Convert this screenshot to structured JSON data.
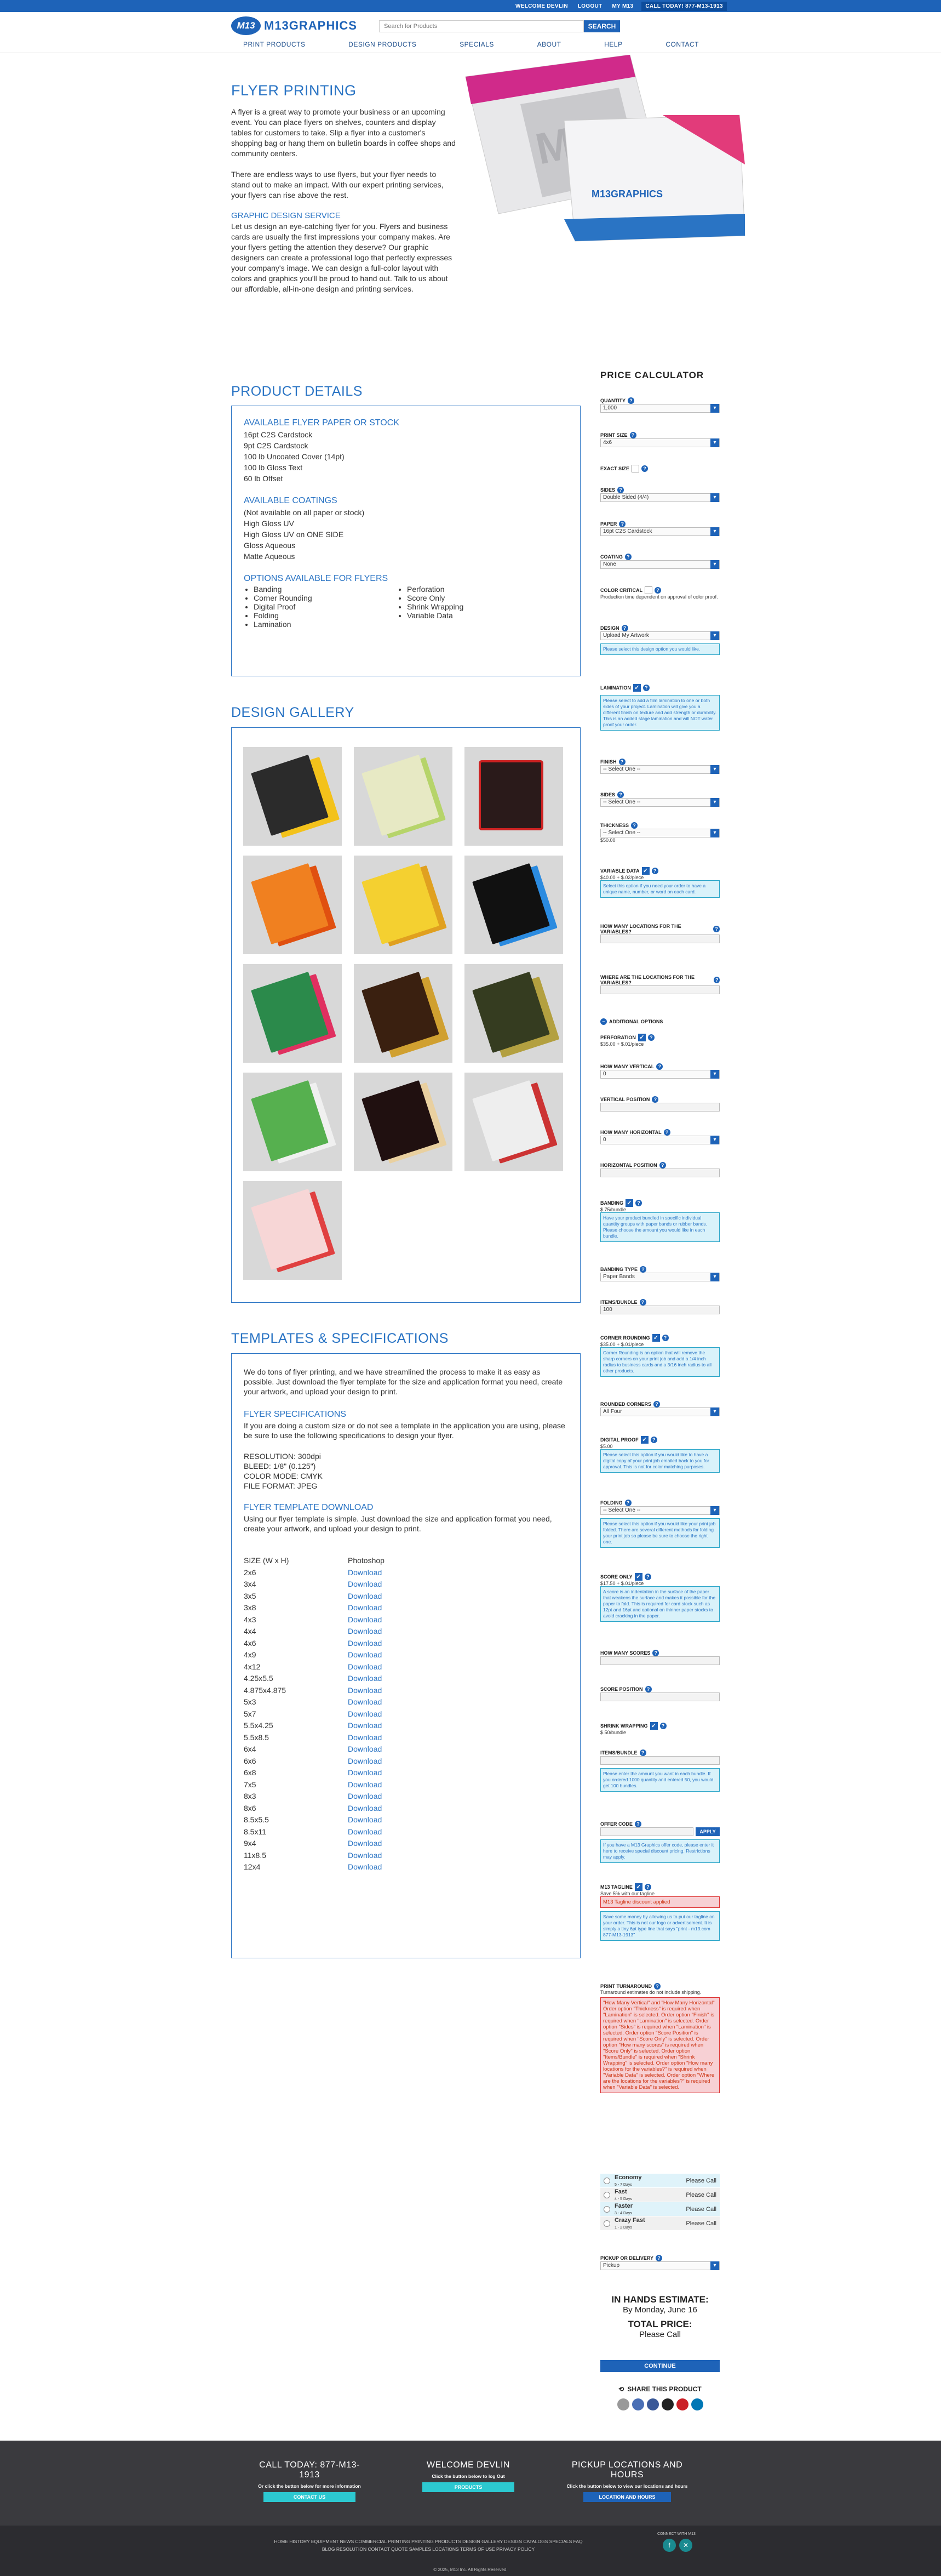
{
  "topbar": {
    "welcome": "WELCOME DEVLIN",
    "logout": "LOGOUT",
    "my": "MY M13",
    "call": "CALL TODAY! 877-M13-1913"
  },
  "header": {
    "brand": "M13GRAPHICS",
    "brand_mark": "M13",
    "search_placeholder": "Search for Products",
    "search_button": "SEARCH"
  },
  "nav": [
    "PRINT PRODUCTS",
    "DESIGN PRODUCTS",
    "SPECIALS",
    "ABOUT",
    "HELP",
    "CONTACT"
  ],
  "hero": {
    "title": "FLYER PRINTING",
    "p1": "A flyer is a great way to promote your business or an upcoming event. You can place flyers on shelves, counters and display tables for customers to take. Slip a flyer into a customer's shopping bag or hang them on bulletin boards in coffee shops and community centers.",
    "p2": "There are endless ways to use flyers, but your flyer needs to stand out to make an impact. With our expert printing services, your flyers can rise above the rest.",
    "sub": "GRAPHIC DESIGN SERVICE",
    "p3": "Let us design an eye-catching flyer for you. Flyers and business cards are usually the first impressions your company makes. Are your flyers getting the attention they deserve? Our graphic designers can create a professional logo that perfectly expresses your company's image. We can design a full-color layout with colors and graphics you'll be proud to hand out. Talk to us about our affordable, all-in-one design and printing services."
  },
  "details": {
    "title": "PRODUCT DETAILS",
    "papers_h": "AVAILABLE FLYER PAPER OR STOCK",
    "papers": [
      "16pt C2S Cardstock",
      "9pt C2S Cardstock",
      "100 lb Uncoated Cover (14pt)",
      "100 lb Gloss Text",
      "60 lb Offset"
    ],
    "coat_h": "AVAILABLE COATINGS",
    "coats": [
      "(Not available on all paper or stock)",
      "High Gloss UV",
      "High Gloss UV on ONE SIDE",
      "Gloss Aqueous",
      "Matte Aqueous"
    ],
    "opts_h": "OPTIONS AVAILABLE FOR FLYERS",
    "opts_a": [
      "Banding",
      "Corner Rounding",
      "Digital Proof",
      "Folding",
      "Lamination"
    ],
    "opts_b": [
      "Perforation",
      "Score Only",
      "Shrink Wrapping",
      "Variable Data"
    ]
  },
  "gallery": {
    "title": "DESIGN GALLERY"
  },
  "templates": {
    "title": "TEMPLATES & SPECIFICATIONS",
    "intro": "We do tons of flyer printing, and we have streamlined the process to make it as easy as possible. Just download the flyer template for the size and application format you need, create your artwork, and upload your design to print.",
    "spec_h": "FLYER SPECIFICATIONS",
    "spec_p": "If you are doing a custom size or do not see a template in the application you are using, please be sure to use the following specifications to design your flyer.",
    "res": "RESOLUTION: 300dpi",
    "bleed": "BLEED: 1/8\" (0.125\")",
    "mode": "COLOR MODE: CMYK",
    "fmt": "FILE FORMAT: JPEG",
    "dl_h": "FLYER TEMPLATE DOWNLOAD",
    "dl_p": "Using our flyer template is simple. Just download the size and application format you need, create your artwork, and upload your design to print.",
    "col1": "SIZE (W x H)",
    "col2": "Photoshop",
    "link": "Download",
    "sizes": [
      "2x6",
      "3x4",
      "3x5",
      "3x8",
      "4x3",
      "4x4",
      "4x6",
      "4x9",
      "4x12",
      "4.25x5.5",
      "4.875x4.875",
      "5x3",
      "5x7",
      "5.5x4.25",
      "5.5x8.5",
      "6x4",
      "6x6",
      "6x8",
      "7x5",
      "8x3",
      "8x6",
      "8.5x5.5",
      "8.5x11",
      "9x4",
      "11x8.5",
      "12x4"
    ]
  },
  "calc": {
    "title": "PRICE CALCULATOR",
    "qty_l": "QUANTITY",
    "qty": "1,000",
    "size_l": "PRINT SIZE",
    "size": "4x6",
    "exact_l": "EXACT SIZE",
    "sides_l": "SIDES",
    "sides": "Double Sided (4/4)",
    "paper_l": "PAPER",
    "paper": "16pt C2S Cardstock",
    "coat_l": "COATING",
    "coat": "None",
    "cc_l": "COLOR CRITICAL",
    "cc_note": "Production time dependent on approval of color proof.",
    "design_l": "DESIGN",
    "design": "Upload My Artwork",
    "design_note": "Please select this design option you would like.",
    "lam_l": "LAMINATION",
    "lam_note": "Please select to add a film lamination to one or both sides of your project. Lamination will give you a different finish on texture and add strength or durability. This is an added stage lamination and will NOT water proof your order.",
    "finish_l": "FINISH",
    "finish": "-- Select One --",
    "lsides_l": "SIDES",
    "lsides": "-- Select One --",
    "thick_l": "THICKNESS",
    "thick": "-- Select One --",
    "thick_p": "$50.00",
    "vd_l": "VARIABLE DATA",
    "vd_p": "$40.00 + $.02/piece",
    "vd_note": "Select this option if you need your order to have a unique name, number, or word on each card.",
    "vloc_l": "HOW MANY LOCATIONS FOR THE VARIABLES?",
    "where_l": "WHERE ARE THE LOCATIONS FOR THE VARIABLES?",
    "addl": "ADDITIONAL OPTIONS",
    "perf_l": "PERFORATION",
    "perf_p": "$35.00 + $.01/piece",
    "hv_l": "HOW MANY VERTICAL",
    "hv": "0",
    "vpos_l": "VERTICAL POSITION",
    "hh_l": "HOW MANY HORIZONTAL",
    "hh": "0",
    "hpos_l": "HORIZONTAL POSITION",
    "band_l": "BANDING",
    "band_p": "$.75/bundle",
    "band_note": "Have your product bundled in specific individual quantity groups with paper bands or rubber bands. Please choose the amount you would like in each bundle.",
    "btype_l": "BANDING TYPE",
    "btype": "Paper Bands",
    "ipb_l": "ITEMS/BUNDLE",
    "ipb": "100",
    "corner_l": "CORNER ROUNDING",
    "corner_p": "$35.00 + $.01/piece",
    "corner_note": "Corner Rounding is an option that will remove the sharp corners on your print job and add a 1/4 inch radius to business cards and a 3/16 inch radius to all other products.",
    "rc_l": "ROUNDED CORNERS",
    "rc": "All Four",
    "dp_l": "DIGITAL PROOF",
    "dp_p": "$5.00",
    "dp_note": "Please select this option if you would like to have a digital copy of your print job emailed back to you for approval. This is not for color matching purposes.",
    "fold_l": "FOLDING",
    "fold": "-- Select One --",
    "fold_note": "Please select this option if you would like your print job folded. There are several different methods for folding your print job so please be sure to choose the right one.",
    "score_l": "SCORE ONLY",
    "score_p": "$17.50 + $.01/piece",
    "score_note": "A score is an indentation in the surface of the paper that weakens the surface and makes it possible for the paper to fold. This is required for card stock such as 12pt and 16pt and optional on thinner paper stocks to avoid cracking in the paper.",
    "hs_l": "HOW MANY SCORES",
    "spos_l": "SCORE POSITION",
    "shrink_l": "SHRINK WRAPPING",
    "shrink_p": "$.50/bundle",
    "ipb2_l": "ITEMS/BUNDLE",
    "shrink_note": "Please enter the amount you want in each bundle. If you ordered 1000 quantity and entered 50, you would get 100 bundles.",
    "offer_l": "OFFER CODE",
    "apply": "APPLY",
    "offer_note": "If you have a M13 Graphics offer code, please enter it here to receive special discount pricing. Restrictions may apply.",
    "tag_l": "M13 TAGLINE",
    "tag_p": "Save 5% with our tagline",
    "tag_err": "M13 Tagline discount applied",
    "tag_note": "Save some money by allowing us to put our tagline on your order. This is not our logo or advertisement. It is simply a tiny 6pt type line that says \"print - m13.com 877-M13-1913\"",
    "turn_l": "PRINT TURNAROUND",
    "turn_note": "Turnaround estimates do not include shipping.",
    "turn_err": "\"How Many Vertical\" and \"How Many Horizontal\" Order option \"Thickness\" is required when \"Lamination\" is selected. Order option \"Finish\" is required when \"Lamination\" is selected. Order option \"Sides\" is required when \"Lamination\" is selected. Order option \"Score Position\" is required when \"Score Only\" is selected. Order option \"How many scores\" is required when \"Score Only\" is selected. Order option \"Items/Bundle\" is required when \"Shrink Wrapping\" is selected. Order option \"How many locations for the variables?\" is required when \"Variable Data\" is selected. Order option \"Where are the locations for the variables?\" is required when \"Variable Data\" is selected.",
    "turns": [
      {
        "n": "Economy",
        "d": "5 - 7 Days",
        "p": "Please Call"
      },
      {
        "n": "Fast",
        "d": "4 - 5 Days",
        "p": "Please Call"
      },
      {
        "n": "Faster",
        "d": "3 - 4 Days",
        "p": "Please Call"
      },
      {
        "n": "Crazy Fast",
        "d": "1 - 2 Days",
        "p": "Please Call"
      }
    ],
    "pickup_l": "PICKUP OR DELIVERY",
    "pickup": "Pickup",
    "inhands_l": "IN HANDS ESTIMATE:",
    "inhands": "By Monday, June 16",
    "total_l": "TOTAL PRICE:",
    "total": "Please Call",
    "cont": "CONTINUE",
    "share": "SHARE THIS PRODUCT"
  },
  "footer": {
    "c1t": "CALL TODAY: 877-M13-1913",
    "c1s": "Or click the button below for more information",
    "c1b": "CONTACT US",
    "c2t": "WELCOME DEVLIN",
    "c2s": "Click the button below to log Out",
    "c2b": "PRODUCTS",
    "c3t": "PICKUP LOCATIONS AND HOURS",
    "c3s": "Click the button below to view our locations and hours",
    "c3b": "LOCATION AND HOURS",
    "links1": "HOME   HISTORY   EQUIPMENT   NEWS   COMMERCIAL PRINTING   PRINTING PRODUCTS   DESIGN GALLERY   DESIGN CATALOGS   SPECIALS   FAQ",
    "links2": "BLOG   RESOLUTION   CONTACT   QUOTE   SAMPLES   LOCATIONS   TERMS OF USE   PRIVACY POLICY",
    "connect": "CONNECT WITH M13",
    "copy": "© 2025, M13 Inc. All Rights Reserved."
  }
}
